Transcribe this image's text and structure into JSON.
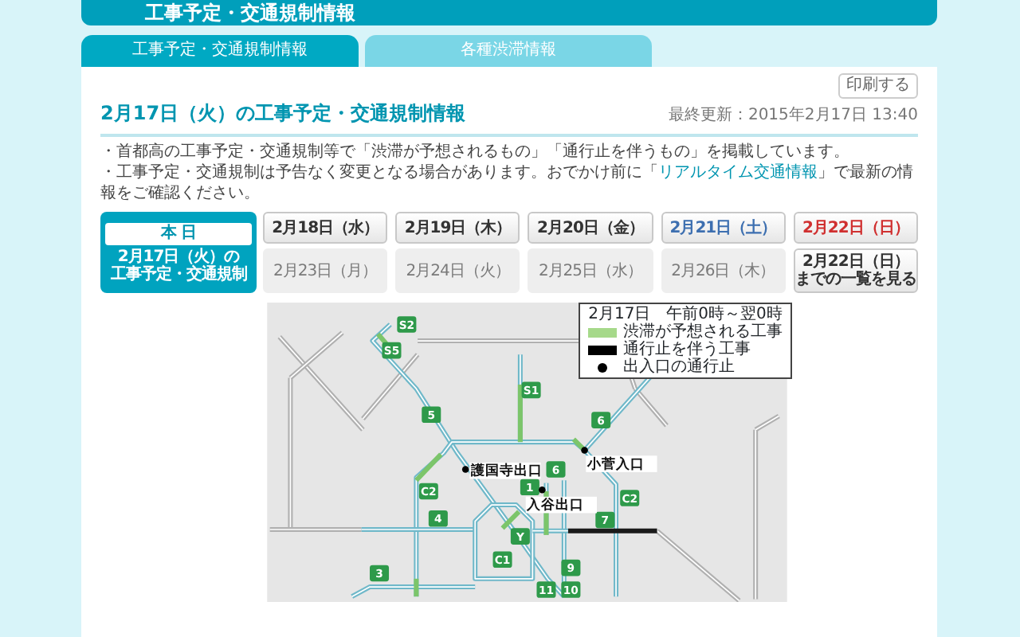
{
  "header": {
    "title": "工事予定・交通規制情報"
  },
  "tabs": [
    {
      "label": "工事予定・交通規制情報",
      "selected": true
    },
    {
      "label": "各種渋滞情報",
      "selected": false
    }
  ],
  "print_button": "印刷する",
  "heading": "2月17日（火）の工事予定・交通規制情報",
  "last_updated": "最終更新：2015年2月17日 13:40",
  "notices": [
    {
      "before": "・首都高の工事予定・交通規制等で「渋滞が予想されるもの」「通行止を伴うもの」を掲載しています。"
    },
    {
      "before": "・工事予定・交通規制は予告なく変更となる場合があります。おでかけ前に「",
      "link": "リアルタイム交通情報",
      "after": "」で最新の情報をご確認ください。"
    }
  ],
  "today": {
    "label": "本 日",
    "caption": [
      "2月17日（火）の",
      "工事予定・交通規制"
    ],
    "selected": true
  },
  "dates": [
    {
      "lines": [
        "2月18日（水）"
      ],
      "kind": "weekday",
      "disabled": false
    },
    {
      "lines": [
        "2月19日（木）"
      ],
      "kind": "weekday",
      "disabled": false
    },
    {
      "lines": [
        "2月20日（金）"
      ],
      "kind": "weekday",
      "disabled": false
    },
    {
      "lines": [
        "2月21日（土）"
      ],
      "kind": "saturday",
      "disabled": false
    },
    {
      "lines": [
        "2月22日（日）"
      ],
      "kind": "sunday",
      "disabled": false
    },
    {
      "lines": [
        "2月23日（月）"
      ],
      "kind": "weekday",
      "disabled": true
    },
    {
      "lines": [
        "2月24日（火）"
      ],
      "kind": "weekday",
      "disabled": true
    },
    {
      "lines": [
        "2月25日（水）"
      ],
      "kind": "weekday",
      "disabled": true
    },
    {
      "lines": [
        "2月26日（木）"
      ],
      "kind": "weekday",
      "disabled": true
    },
    {
      "lines": [
        "2月22日（日）",
        "までの一覧を見る"
      ],
      "kind": "list",
      "disabled": false
    }
  ],
  "map": {
    "legend": {
      "title": "2月17日　午前0時～翌0時",
      "items": [
        {
          "kind": "congestion",
          "label": "渋滞が予想される工事"
        },
        {
          "kind": "closure",
          "label": "通行止を伴う工事"
        },
        {
          "kind": "exit-closure",
          "label": "出入口の通行止"
        }
      ]
    },
    "route_badges": [
      "S2",
      "S5",
      "5",
      "S1",
      "6",
      "C2",
      "4",
      "1",
      "6",
      "Y",
      "C1",
      "3",
      "9",
      "10",
      "11",
      "7",
      "C2"
    ],
    "exits": [
      {
        "label": "護国寺出口"
      },
      {
        "label": "入谷出口"
      },
      {
        "label": "小菅入口"
      }
    ]
  }
}
